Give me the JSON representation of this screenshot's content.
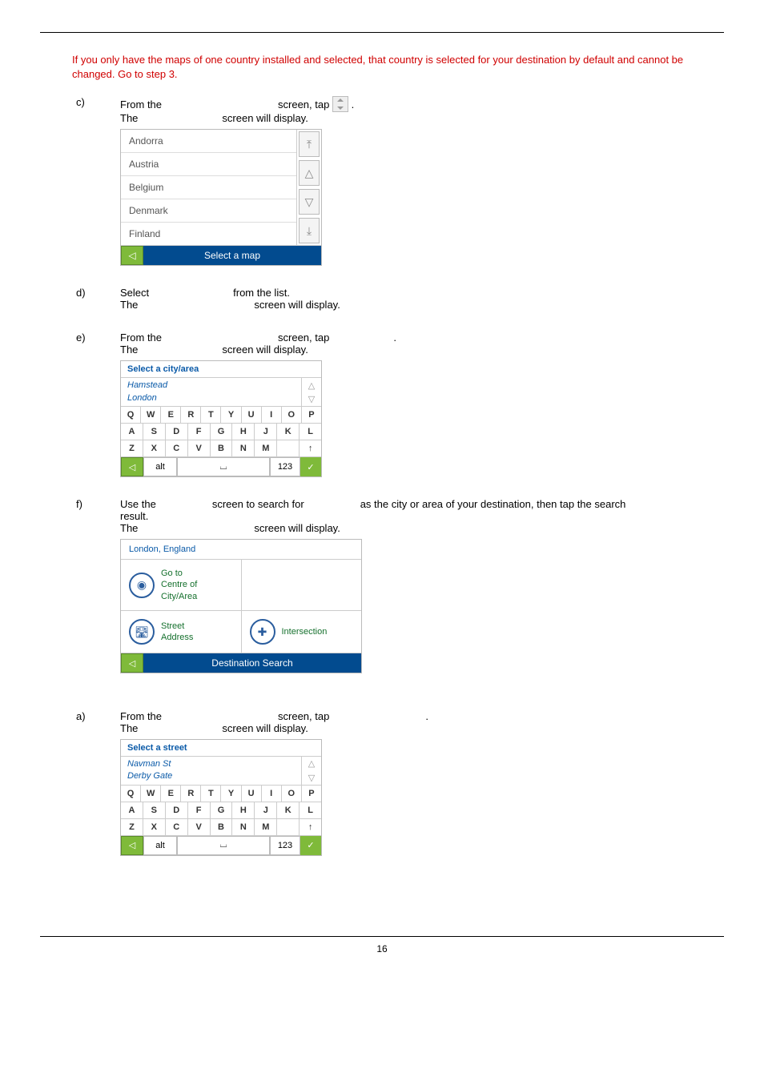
{
  "note": "If you only have the maps of one country installed and selected, that country is selected for your destination by default and cannot be changed. Go to step 3.",
  "step_c": {
    "letter": "c)",
    "line1_a": "From the",
    "line1_b": "screen, tap",
    "line2_a": "The",
    "line2_b": "screen will display."
  },
  "country_list": {
    "items": [
      "Andorra",
      "Austria",
      "Belgium",
      "Denmark",
      "Finland"
    ],
    "footer": "Select a map"
  },
  "step_d": {
    "letter": "d)",
    "line1_a": "Select",
    "line1_b": "from the list.",
    "line2_a": "The",
    "line2_b": "screen will display."
  },
  "step_e": {
    "letter": "e)",
    "line1_a": "From the",
    "line1_b": "screen, tap",
    "line1_c": ".",
    "line2_a": "The",
    "line2_b": "screen will display."
  },
  "kbd1": {
    "title": "Select a city/area",
    "input_line1": "Hamstead",
    "input_line2": "London",
    "row1": [
      "Q",
      "W",
      "E",
      "R",
      "T",
      "Y",
      "U",
      "I",
      "O",
      "P"
    ],
    "row2": [
      "A",
      "S",
      "D",
      "F",
      "G",
      "H",
      "J",
      "K",
      "L"
    ],
    "row3": [
      "Z",
      "X",
      "C",
      "V",
      "B",
      "N",
      "M",
      "",
      "↑"
    ],
    "alt": "alt",
    "space": "⌴",
    "num": "123",
    "ok": "✓"
  },
  "step_f": {
    "letter": "f)",
    "line1_a": "Use the",
    "line1_b": "screen to search for",
    "line1_c": "as the city or area of your destination, then tap the search",
    "line2": "result.",
    "line3_a": "The",
    "line3_b": "screen will display."
  },
  "dest": {
    "header": "London, England",
    "cell1": "Go to\nCentre of\nCity/Area",
    "cell2": "Street\nAddress",
    "cell3": "Intersection",
    "footer": "Destination Search"
  },
  "step_a": {
    "letter": "a)",
    "line1_a": "From the",
    "line1_b": "screen, tap",
    "line1_c": ".",
    "line2_a": "The",
    "line2_b": "screen will display."
  },
  "kbd2": {
    "title": "Select a street",
    "input_line1": "Navman St",
    "input_line2": "Derby Gate",
    "row1": [
      "Q",
      "W",
      "E",
      "R",
      "T",
      "Y",
      "U",
      "I",
      "O",
      "P"
    ],
    "row2": [
      "A",
      "S",
      "D",
      "F",
      "G",
      "H",
      "J",
      "K",
      "L"
    ],
    "row3": [
      "Z",
      "X",
      "C",
      "V",
      "B",
      "N",
      "M",
      "",
      "↑"
    ],
    "alt": "alt",
    "space": "⌴",
    "num": "123",
    "ok": "✓"
  },
  "page_number": "16"
}
